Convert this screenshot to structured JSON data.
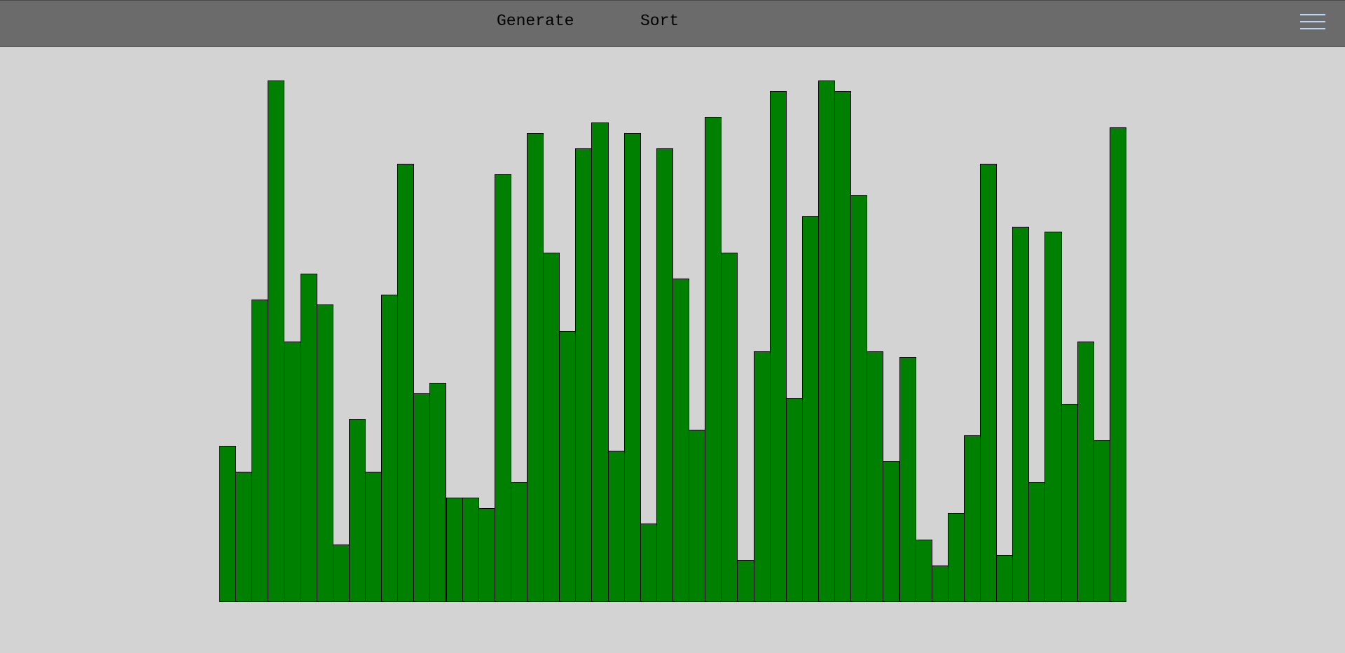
{
  "toolbar": {
    "generate_label": "Generate",
    "sort_label": "Sort",
    "menu_icon": "hamburger-menu-icon",
    "menu_icon_color": "#b9d7f2"
  },
  "colors": {
    "background": "#d3d3d3",
    "topbar": "#6b6b6b",
    "bar_fill": "#008000",
    "bar_border": "#000000"
  },
  "chart_data": {
    "type": "bar",
    "title": "",
    "xlabel": "",
    "ylabel": "",
    "ylim": [
      0,
      100
    ],
    "values": [
      30,
      25,
      58,
      100,
      50,
      63,
      57,
      11,
      35,
      25,
      59,
      84,
      40,
      42,
      20,
      20,
      18,
      82,
      23,
      90,
      67,
      52,
      87,
      92,
      29,
      90,
      15,
      87,
      62,
      33,
      93,
      67,
      8,
      48,
      98,
      39,
      74,
      100,
      98,
      78,
      48,
      27,
      47,
      12,
      7,
      17,
      32,
      84,
      9,
      72,
      23,
      71,
      38,
      50,
      31,
      91
    ]
  }
}
